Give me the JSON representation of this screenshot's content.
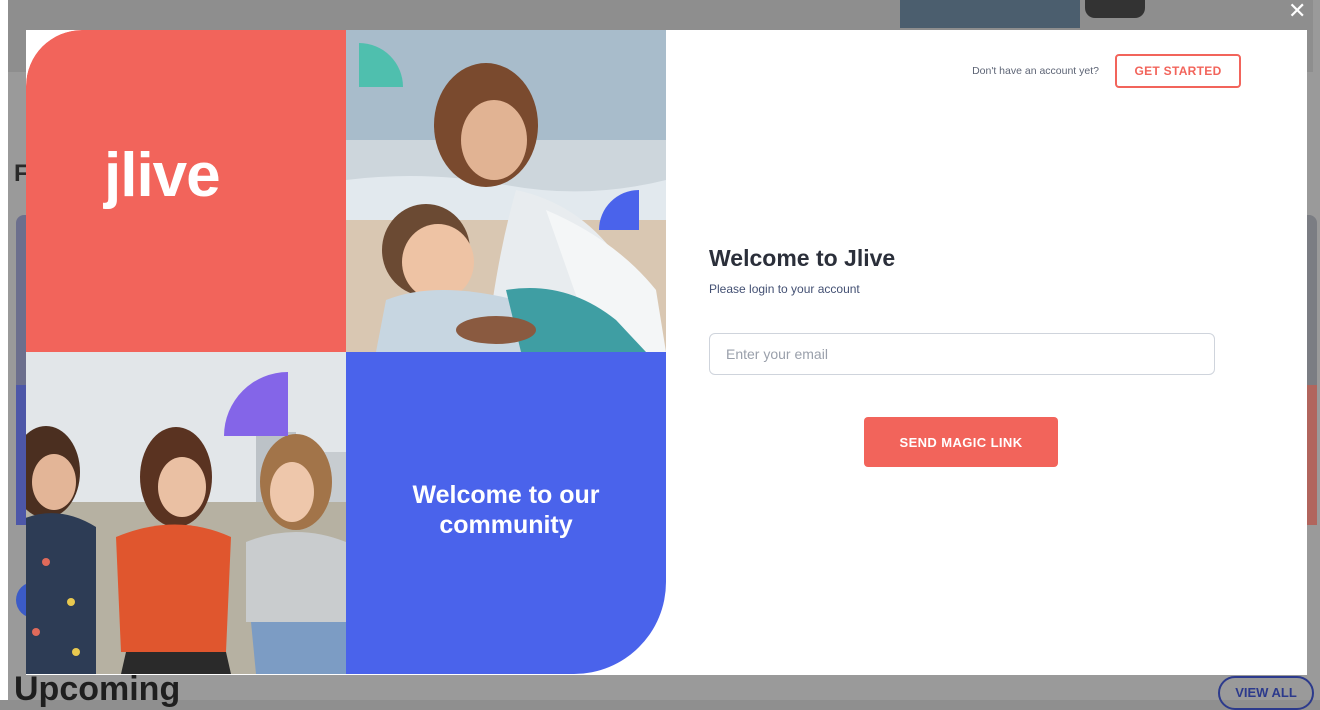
{
  "background": {
    "heading_fragment": "F",
    "upcoming_heading": "Upcoming",
    "view_all_label": "VIEW ALL"
  },
  "modal": {
    "close_glyph": "✕",
    "brand": {
      "logo_text": "jlive",
      "community_text": "Welcome to our community"
    },
    "header": {
      "no_account_text": "Don't have an account yet?",
      "get_started_label": "GET STARTED"
    },
    "login": {
      "title": "Welcome to Jlive",
      "subtitle": "Please login to your account",
      "email_placeholder": "Enter your email",
      "email_value": "",
      "submit_label": "SEND MAGIC LINK"
    }
  },
  "colors": {
    "coral": "#f2645b",
    "blue": "#4a63eb",
    "teal": "#4fbfae",
    "purple": "#8465e8",
    "text_dark": "#2b2f3a"
  },
  "icons": {
    "close": "close-icon"
  }
}
